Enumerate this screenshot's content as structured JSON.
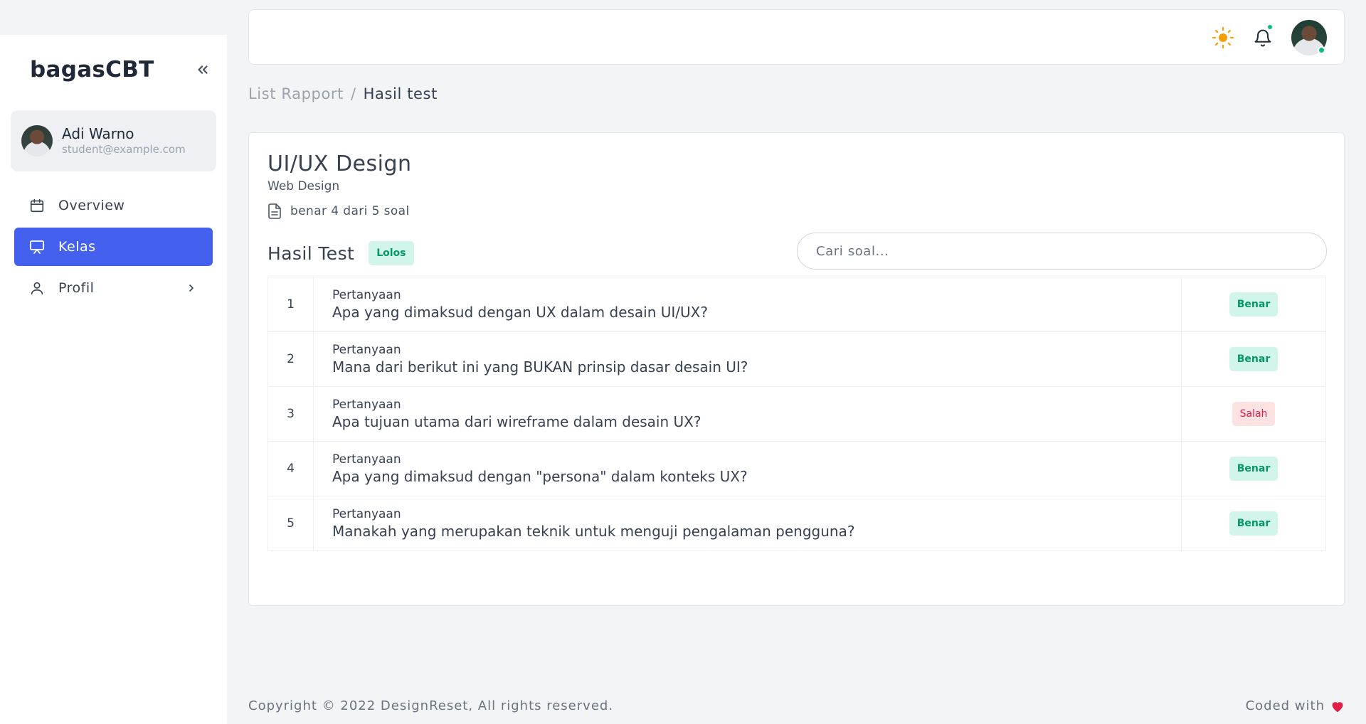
{
  "sidebar": {
    "brand": "bagasCBT",
    "user": {
      "name": "Adi Warno",
      "email": "student@example.com"
    },
    "items": [
      {
        "label": "Overview",
        "icon": "calendar-icon",
        "active": false
      },
      {
        "label": "Kelas",
        "icon": "presentation-icon",
        "active": true
      },
      {
        "label": "Profil",
        "icon": "user-icon",
        "active": false
      }
    ]
  },
  "header": {
    "icons": [
      "sun-icon",
      "bell-icon",
      "avatar"
    ]
  },
  "breadcrumb": {
    "parent": "List Rapport",
    "separator": "/",
    "current": "Hasil test"
  },
  "course": {
    "title": "UI/UX Design",
    "subtitle": "Web Design",
    "score_text": "benar 4 dari 5 soal"
  },
  "results": {
    "title": "Hasil Test",
    "status": "Lolos",
    "search_placeholder": "Cari soal...",
    "rows": [
      {
        "no": "1",
        "label": "Pertanyaan",
        "question": "Apa yang dimaksud dengan UX dalam desain UI/UX?",
        "result": "Benar"
      },
      {
        "no": "2",
        "label": "Pertanyaan",
        "question": "Mana dari berikut ini yang BUKAN prinsip dasar desain UI?",
        "result": "Benar"
      },
      {
        "no": "3",
        "label": "Pertanyaan",
        "question": "Apa tujuan utama dari wireframe dalam desain UX?",
        "result": "Salah"
      },
      {
        "no": "4",
        "label": "Pertanyaan",
        "question": "Apa yang dimaksud dengan \"persona\" dalam konteks UX?",
        "result": "Benar"
      },
      {
        "no": "5",
        "label": "Pertanyaan",
        "question": "Manakah yang merupakan teknik untuk menguji pengalaman pengguna?",
        "result": "Benar"
      }
    ]
  },
  "footer": {
    "copyright": "Copyright © 2022 DesignReset, All rights reserved.",
    "coded_with": "Coded with"
  },
  "colors": {
    "accent": "#4361ee",
    "success": "#059669",
    "danger": "#e11d48",
    "sun": "#f59e0b",
    "heart": "#e11d48"
  }
}
